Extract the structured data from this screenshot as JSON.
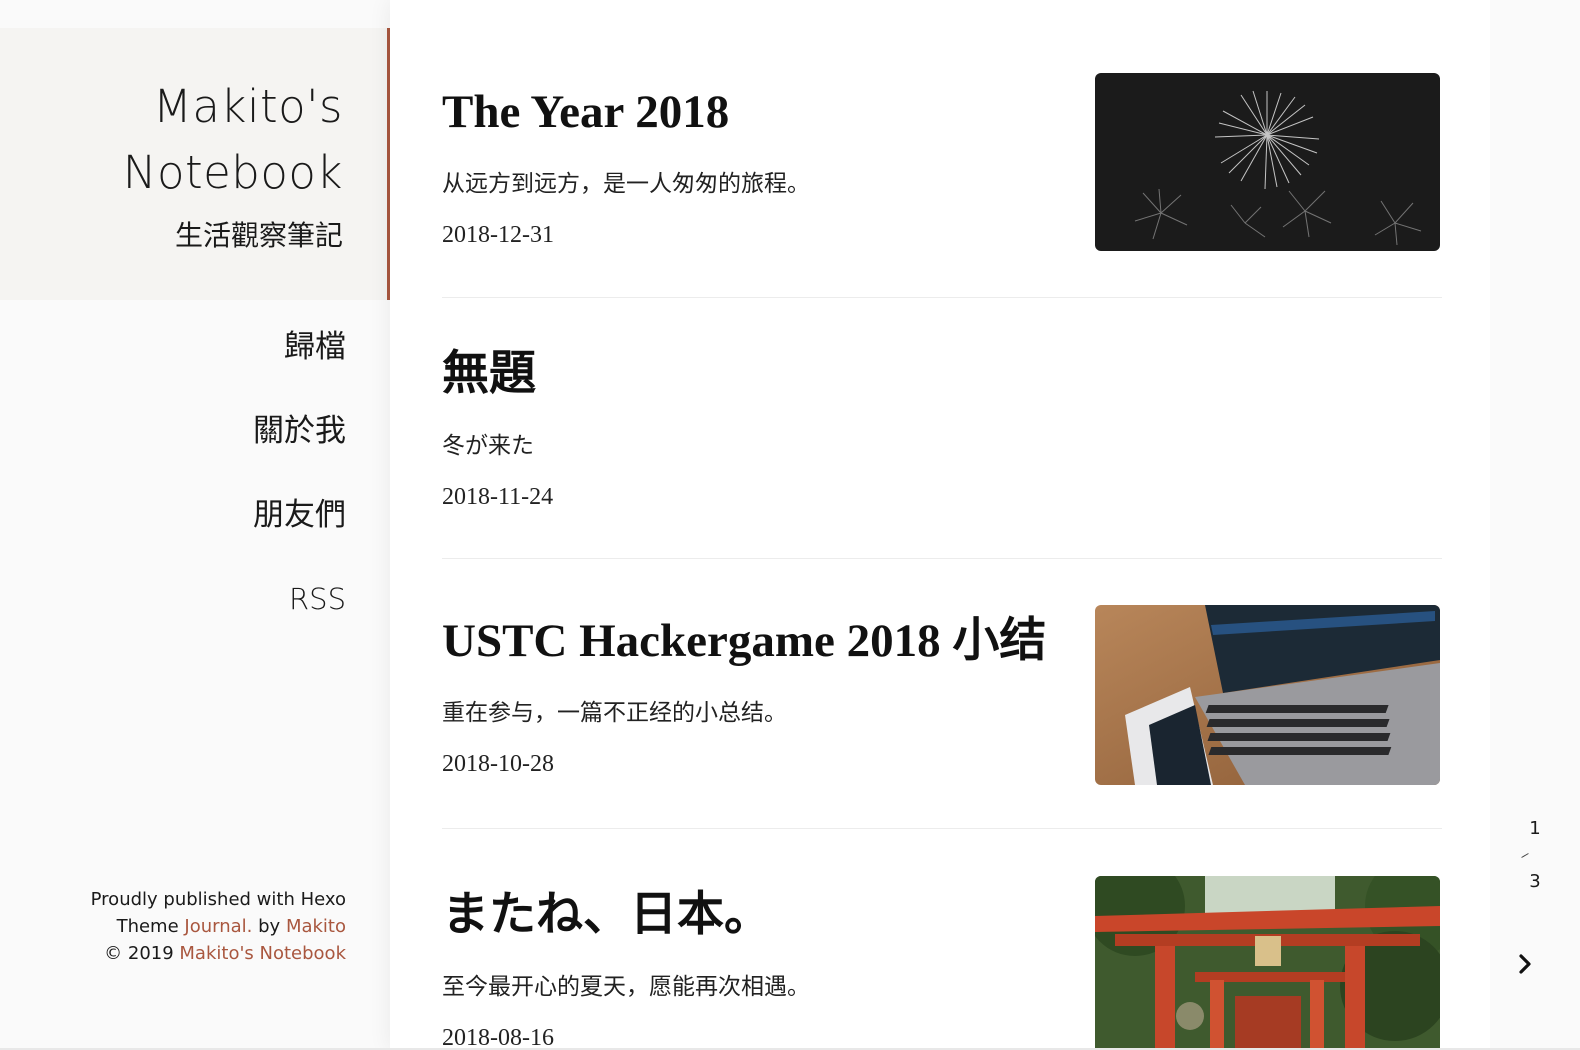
{
  "brand": {
    "title_line1": "Makito's",
    "title_line2": "Notebook",
    "subtitle": "生活觀察筆記"
  },
  "nav": {
    "items": [
      {
        "label": "歸檔"
      },
      {
        "label": "關於我"
      },
      {
        "label": "朋友們"
      },
      {
        "label": "RSS"
      }
    ]
  },
  "footer": {
    "published": "Proudly published with Hexo",
    "theme_prefix": "Theme",
    "theme_link": "Journal.",
    "theme_by": "by",
    "author_link": "Makito",
    "copyright": "© 2019",
    "site_link": "Makito's Notebook"
  },
  "posts": [
    {
      "title": "The Year 2018",
      "excerpt": "从远方到远方，是一人匆匆的旅程。",
      "date": "2018-12-31",
      "thumbnail": "fireworks-image"
    },
    {
      "title": "無題",
      "excerpt": "冬が来た",
      "date": "2018-11-24",
      "thumbnail": ""
    },
    {
      "title": "USTC Hackergame 2018 小结",
      "excerpt": "重在参与，一篇不正经的小总结。",
      "date": "2018-10-28",
      "thumbnail": "laptop-phone-image"
    },
    {
      "title": "またね、日本。",
      "excerpt": "至今最开心的夏天，愿能再次相遇。",
      "date": "2018-08-16",
      "thumbnail": "torii-gate-image"
    }
  ],
  "pagination": {
    "current": "1",
    "total": "3",
    "next_icon": "chevron-right-icon"
  },
  "colors": {
    "accent": "#a9573f",
    "sidebar_bg": "#fafafa",
    "brand_bg": "#f5f4f2",
    "content_bg": "#ffffff"
  }
}
